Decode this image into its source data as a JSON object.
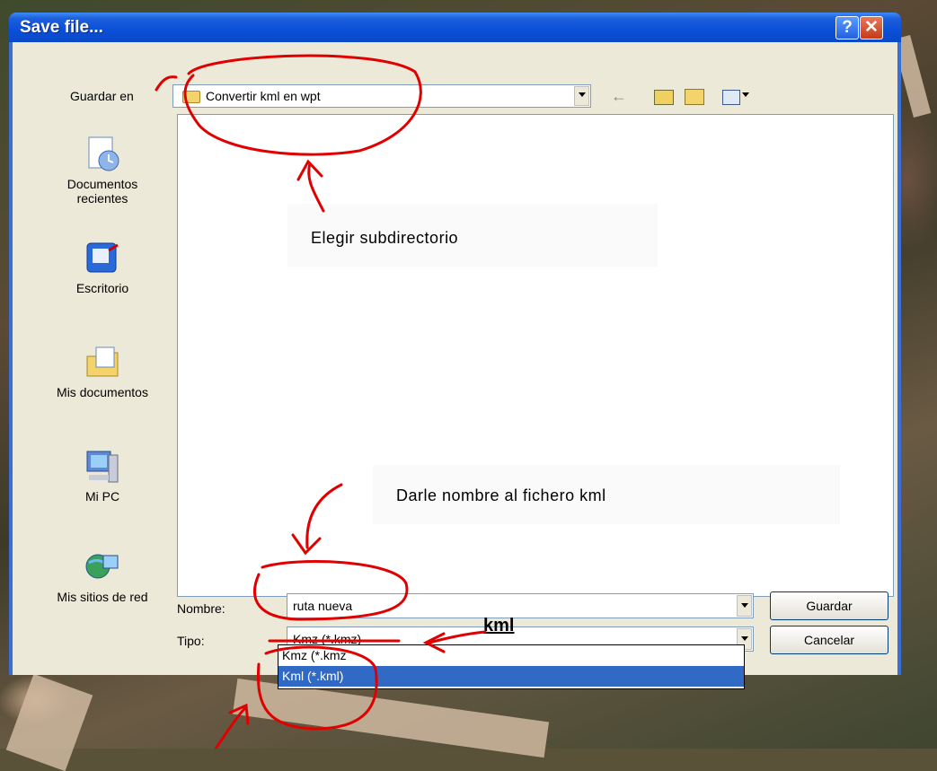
{
  "dialog": {
    "title": "Save file...",
    "save_in_label": "Guardar en",
    "current_folder": "Convertir kml en wpt",
    "filename_label": "Nombre:",
    "filename_value": "ruta nueva",
    "type_label": "Tipo:",
    "type_value": "Kmz (*.kmz)",
    "type_options": [
      "Kmz (*.kmz",
      "Kml (*.kml)"
    ],
    "save_button": "Guardar",
    "cancel_button": "Cancelar",
    "help_glyph": "?",
    "close_glyph": "✕"
  },
  "places": [
    {
      "label_line1": "Documentos",
      "label_line2": "recientes",
      "icon": "recent-documents-icon"
    },
    {
      "label_line1": "Escritorio",
      "label_line2": "",
      "icon": "desktop-icon"
    },
    {
      "label_line1": "Mis documentos",
      "label_line2": "",
      "icon": "my-documents-icon"
    },
    {
      "label_line1": "Mi PC",
      "label_line2": "",
      "icon": "my-computer-icon"
    },
    {
      "label_line1": "Mis sitios de red",
      "label_line2": "",
      "icon": "network-places-icon"
    }
  ],
  "annotations": {
    "note1": "Elegir subdirectorio",
    "note2": "Darle nombre al fichero kml",
    "kml_label": "kml"
  },
  "colors": {
    "annotation": "#e00000",
    "titlebar": "#0a4fd8",
    "selection": "#316ac5"
  }
}
